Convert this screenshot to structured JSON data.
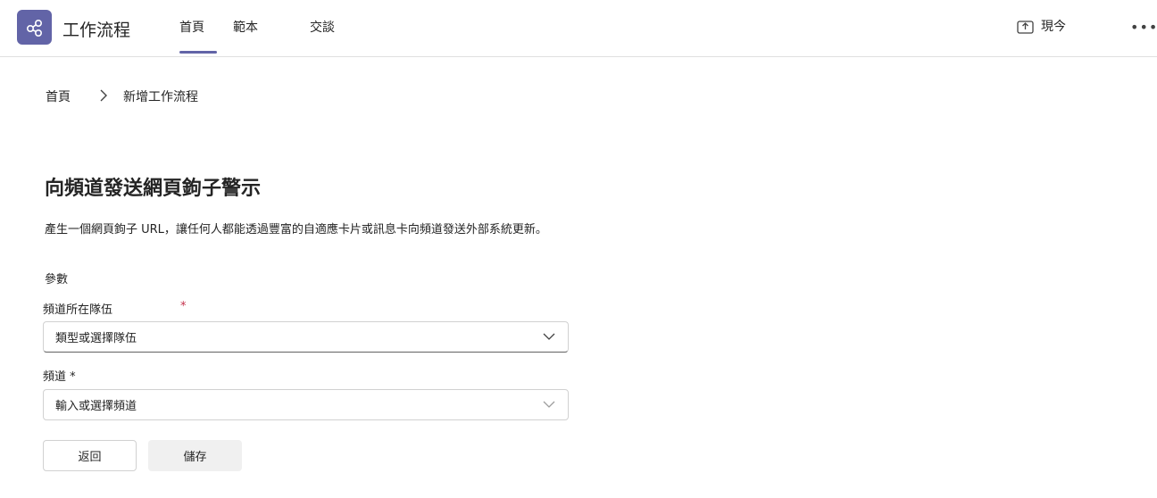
{
  "app": {
    "title": "工作流程"
  },
  "tabs": [
    {
      "label": "首頁",
      "active": true
    },
    {
      "label": "範本",
      "active": false
    },
    {
      "label": "交談",
      "active": false
    }
  ],
  "header": {
    "share_label": "現今",
    "more_label": "•••"
  },
  "breadcrumb": {
    "home": "首頁",
    "current": "新增工作流程"
  },
  "form": {
    "title": "向頻道發送網頁鉤子警示",
    "description": "產生一個網頁鉤子 URL，讓任何人都能透過豐富的自適應卡片或訊息卡向頻道發送外部系統更新。",
    "section_label": "參數",
    "team_label": "頻道所在隊伍",
    "team_required": "*",
    "team_placeholder": "類型或選擇隊伍",
    "channel_label": "頻道 *",
    "channel_placeholder": "輸入或選擇頻道"
  },
  "buttons": {
    "back": "返回",
    "save": "儲存"
  },
  "colors": {
    "accent": "#6264a7",
    "required": "#c4314b"
  }
}
